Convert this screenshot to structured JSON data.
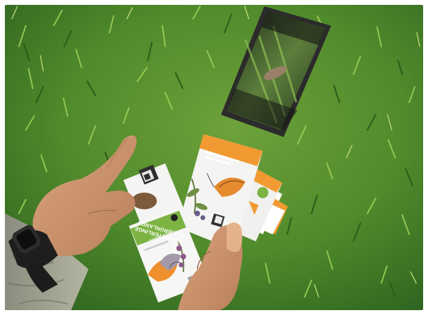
{
  "photo": {
    "main_card_title_line1": "SCHMETTERLINGE",
    "main_card_title_line2": "DES GRÜNLANDS",
    "colors": {
      "grass": "#4e8a2a",
      "card_orange": "#f2962d",
      "card_green": "#7cb342",
      "phone": "#2a2a2a"
    }
  }
}
